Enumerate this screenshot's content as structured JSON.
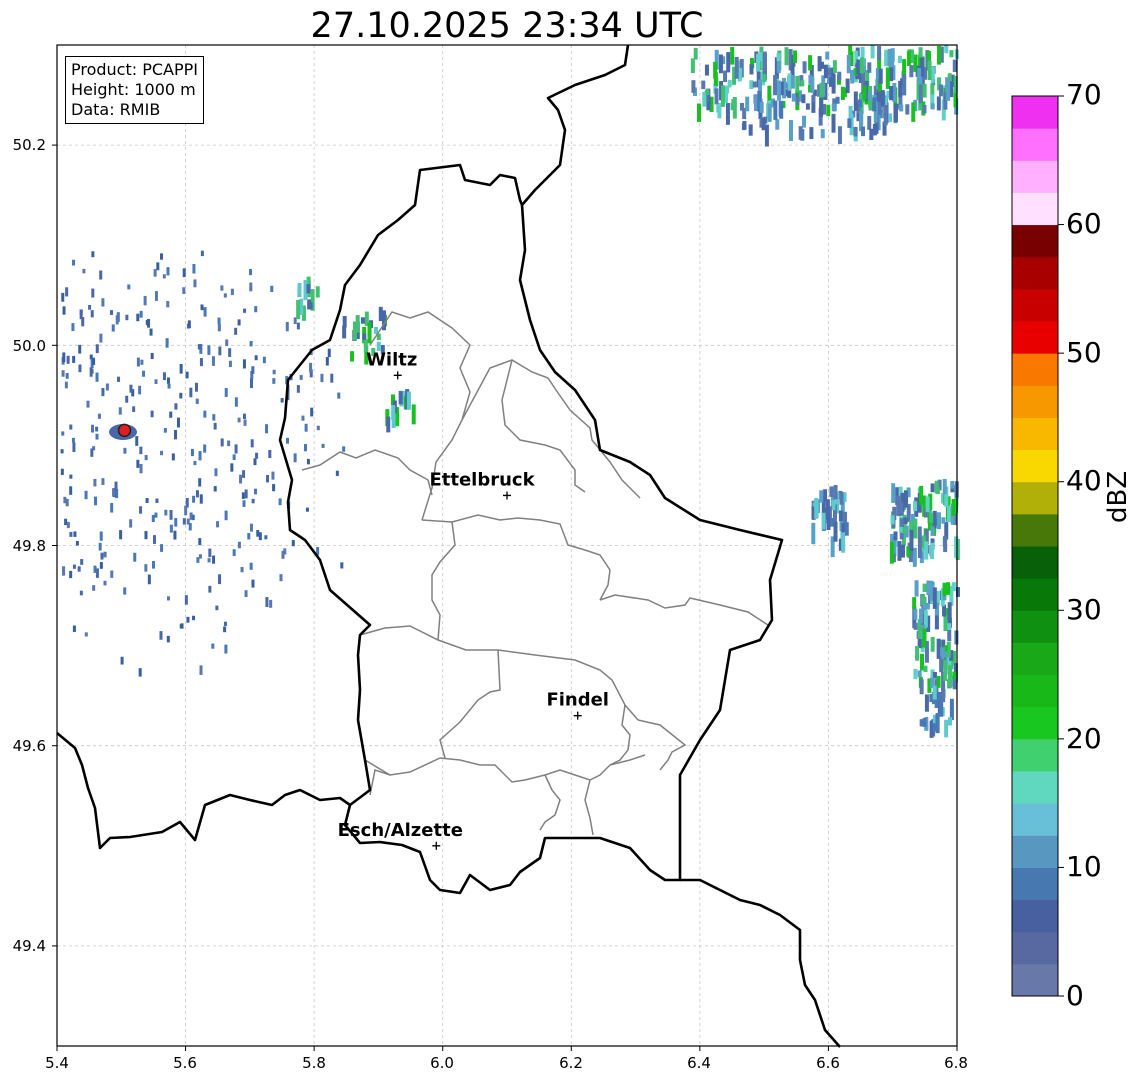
{
  "title": "27.10.2025 23:34 UTC",
  "info": {
    "product": "Product: PCAPPI",
    "height": "Height: 1000 m",
    "data": "Data: RMIB"
  },
  "x_ticks": [
    "5.4",
    "5.6",
    "5.8",
    "6.0",
    "6.2",
    "6.4",
    "6.6",
    "6.8"
  ],
  "y_ticks": [
    "50.2",
    "50.0",
    "49.8",
    "49.6",
    "49.4"
  ],
  "colorbar": {
    "label": "dBZ",
    "range": [
      0,
      70
    ],
    "ticks": [
      "0",
      "10",
      "20",
      "30",
      "40",
      "50",
      "60",
      "70"
    ],
    "colors": [
      "#6878a8",
      "#5868a0",
      "#4860a0",
      "#4878b0",
      "#5898c0",
      "#68c0d8",
      "#60d8c0",
      "#40d070",
      "#18c820",
      "#18b818",
      "#18a818",
      "#109010",
      "#087808",
      "#086008",
      "#487808",
      "#b0b008",
      "#f8d800",
      "#f8b800",
      "#f89800",
      "#f87800",
      "#e80000",
      "#c80000",
      "#a80000",
      "#780000",
      "#ffe0ff",
      "#ffb0ff",
      "#ff70ff",
      "#f030f0"
    ]
  },
  "map": {
    "lon_range": [
      5.4,
      6.8
    ],
    "lat_range": [
      49.3,
      50.3
    ],
    "grid": true,
    "cities": [
      {
        "name": "Wiltz",
        "lon": 5.93,
        "lat": 49.97
      },
      {
        "name": "Ettelbruck",
        "lon": 6.1,
        "lat": 49.85
      },
      {
        "name": "Findel",
        "lon": 6.21,
        "lat": 49.63
      },
      {
        "name": "Esch/Alzette",
        "lon": 5.99,
        "lat": 49.5
      }
    ],
    "radar_site": {
      "lon": 5.505,
      "lat": 49.915
    }
  }
}
